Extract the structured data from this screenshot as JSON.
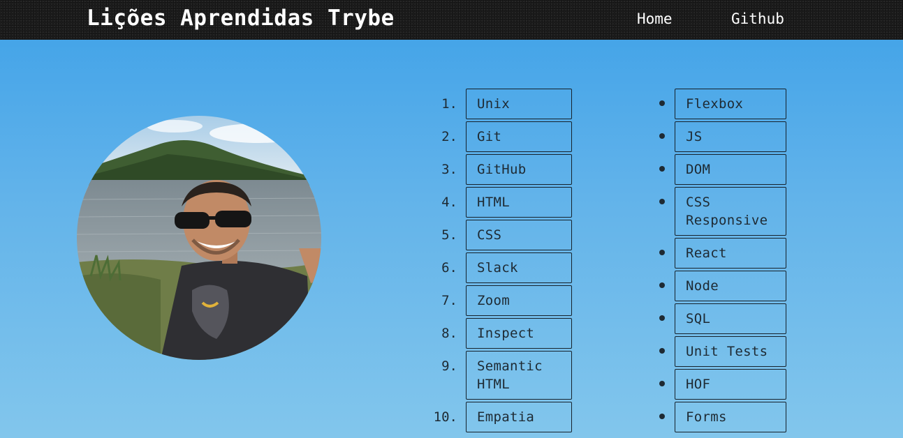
{
  "header": {
    "title": "Lições Aprendidas Trybe",
    "nav": {
      "home": "Home",
      "github": "Github"
    }
  },
  "colors": {
    "header_bg": "#1c1c1c",
    "page_bg_top": "#3ea1e8",
    "page_bg_bottom": "#82c6ec",
    "text_dark": "#1e2a33",
    "nav_text": "#ffffff"
  },
  "profile": {
    "image": "profile-photo"
  },
  "ordered_list": [
    {
      "marker": "1.",
      "label": "Unix"
    },
    {
      "marker": "2.",
      "label": "Git"
    },
    {
      "marker": "3.",
      "label": "GitHub"
    },
    {
      "marker": "4.",
      "label": "HTML"
    },
    {
      "marker": "5.",
      "label": "CSS"
    },
    {
      "marker": "6.",
      "label": "Slack"
    },
    {
      "marker": "7.",
      "label": "Zoom"
    },
    {
      "marker": "8.",
      "label": "Inspect"
    },
    {
      "marker": "9.",
      "label": "Semantic HTML"
    },
    {
      "marker": "10.",
      "label": "Empatia"
    }
  ],
  "unordered_list": [
    {
      "label": "Flexbox"
    },
    {
      "label": "JS"
    },
    {
      "label": "DOM"
    },
    {
      "label": "CSS Responsive"
    },
    {
      "label": "React"
    },
    {
      "label": "Node"
    },
    {
      "label": "SQL"
    },
    {
      "label": "Unit Tests"
    },
    {
      "label": "HOF"
    },
    {
      "label": "Forms"
    }
  ]
}
